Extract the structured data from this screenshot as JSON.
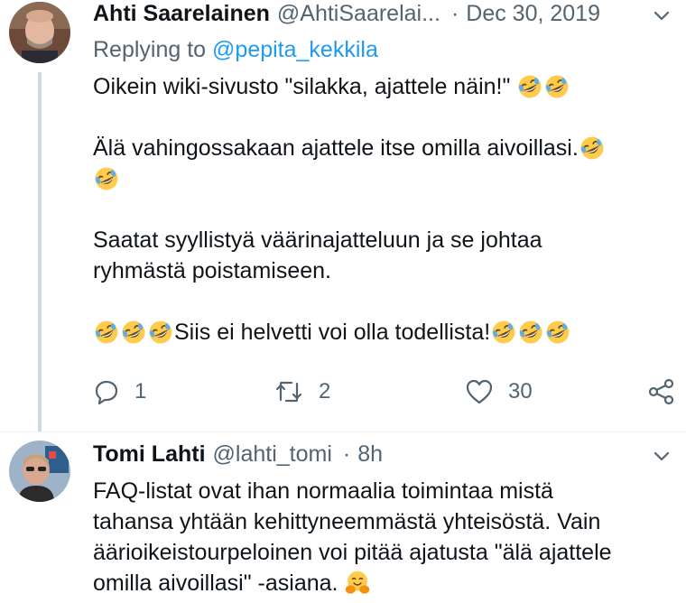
{
  "tweets": [
    {
      "name": "Ahti Saarelainen",
      "handle": "@AhtiSaarelai...",
      "separator": "·",
      "time": "Dec 30, 2019",
      "replying_prefix": "Replying to ",
      "replying_to": "@pepita_kekkila",
      "lines": [
        "Oikein wiki-sivusto \"silakka, ajattele näin!\" ",
        "Älä vahingossakaan ajattele itse omilla aivoillasi.",
        "Saatat syyllistyä väärinajatteluun ja se johtaa",
        "ryhmästä poistamiseen.",
        "Siis ei helvetti voi olla todellista!"
      ],
      "emoji": {
        "laughing": "rolling-on-floor-laughing-emoji",
        "hugging": "hugging-face-emoji"
      },
      "reply_count": "1",
      "retweet_count": "2",
      "like_count": "30"
    },
    {
      "name": "Tomi Lahti",
      "handle": "@lahti_tomi",
      "separator": "·",
      "time": "8h",
      "lines": [
        "FAQ-listat ovat ihan normaalia toimintaa mistä",
        "tahansa yhtään kehittyneemmästä yhteisöstä. Vain",
        "äärioikeistourpeloinen voi pitää ajatusta \"älä ajattele",
        "omilla aivoillasi\" -asiana. "
      ]
    }
  ],
  "colors": {
    "text": "#0f1419",
    "secondary": "#536471",
    "link": "#1d9bf0",
    "thread_line": "#cfd9de",
    "emoji_face": "#ffcb4c"
  }
}
